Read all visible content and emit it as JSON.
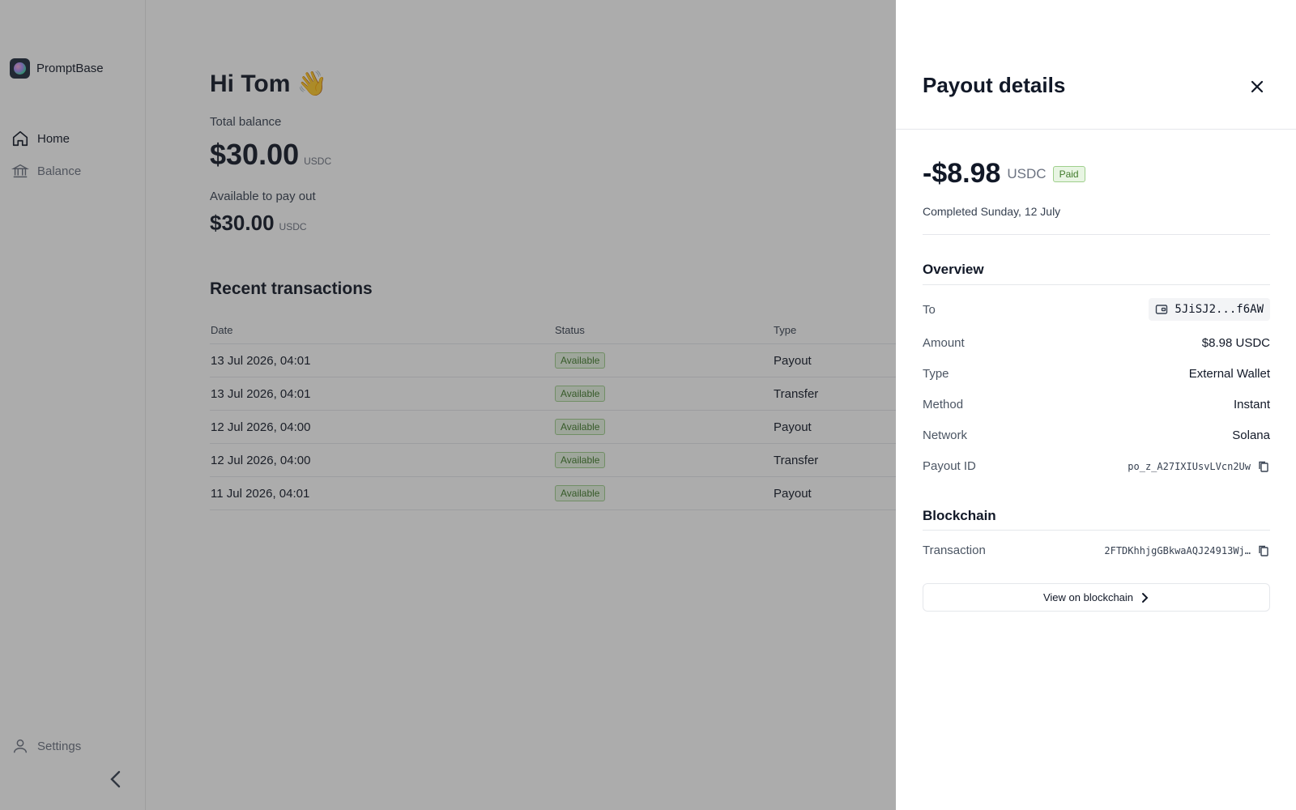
{
  "app": {
    "name": "PromptBase"
  },
  "nav": {
    "items": [
      {
        "label": "Home",
        "icon": "home-icon",
        "active": true
      },
      {
        "label": "Balance",
        "icon": "bank-icon",
        "active": false
      }
    ],
    "settings": {
      "label": "Settings",
      "icon": "user-icon"
    }
  },
  "dashboard": {
    "greeting": "Hi Tom 👋",
    "total_balance": {
      "label": "Total balance",
      "amount": "$30.00",
      "unit": "USDC"
    },
    "available": {
      "label": "Available to pay out",
      "amount": "$30.00",
      "unit": "USDC"
    },
    "recent_title": "Recent transactions",
    "columns": [
      "Date",
      "Status",
      "Type"
    ],
    "rows": [
      {
        "date": "13 Jul 2026, 04:01",
        "status": "Available",
        "type": "Payout"
      },
      {
        "date": "13 Jul 2026, 04:01",
        "status": "Available",
        "type": "Transfer"
      },
      {
        "date": "12 Jul 2026, 04:00",
        "status": "Available",
        "type": "Payout"
      },
      {
        "date": "12 Jul 2026, 04:00",
        "status": "Available",
        "type": "Transfer"
      },
      {
        "date": "11 Jul 2026, 04:01",
        "status": "Available",
        "type": "Payout"
      }
    ]
  },
  "drawer": {
    "title": "Payout details",
    "amount": "-$8.98",
    "unit": "USDC",
    "badge": "Paid",
    "completed": "Completed Sunday, 12 July",
    "overview": {
      "title": "Overview",
      "to_label": "To",
      "to_value": "5JiSJ2...f6AW",
      "amount_label": "Amount",
      "amount_value": "$8.98 USDC",
      "type_label": "Type",
      "type_value": "External Wallet",
      "method_label": "Method",
      "method_value": "Instant",
      "network_label": "Network",
      "network_value": "Solana",
      "payout_id_label": "Payout ID",
      "payout_id_value": "po_z_A27IXIUsvLVcn2Uw"
    },
    "blockchain": {
      "title": "Blockchain",
      "transaction_label": "Transaction",
      "transaction_value": "2FTDKhhjgGBkwaAQJ24913Wj…",
      "view_button": "View on blockchain"
    }
  },
  "colors": {
    "accent_green": "#3f7a2a",
    "badge_bg": "#e8f5e3",
    "overlay": "rgba(40,40,40,0.39)"
  }
}
